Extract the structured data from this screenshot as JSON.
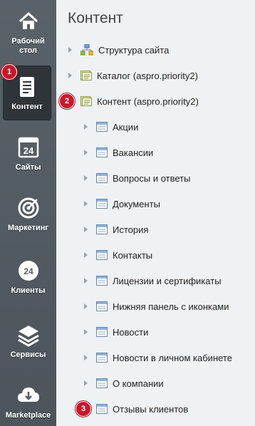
{
  "sidebar": {
    "items": [
      {
        "label": "Рабочий стол",
        "icon": "home-icon"
      },
      {
        "label": "Контент",
        "icon": "document-icon",
        "active": true
      },
      {
        "label": "Сайты",
        "icon": "calendar-24-icon"
      },
      {
        "label": "Маркетинг",
        "icon": "target-icon"
      },
      {
        "label": "Клиенты",
        "icon": "clients-24-icon"
      },
      {
        "label": "Сервисы",
        "icon": "layers-icon"
      },
      {
        "label": "Marketplace",
        "icon": "cloud-download-icon"
      }
    ]
  },
  "badges": [
    "1",
    "2",
    "3"
  ],
  "main": {
    "title": "Контент",
    "tree": [
      {
        "label": "Структура сайта",
        "icon": "site-structure-icon"
      },
      {
        "label": "Каталог (aspro.priority2)",
        "icon": "infoblock-type-icon"
      },
      {
        "label": "Контент (aspro.priority2)",
        "icon": "infoblock-type-icon"
      },
      {
        "label": "Акции",
        "icon": "infoblock-icon"
      },
      {
        "label": "Вакансии",
        "icon": "infoblock-icon"
      },
      {
        "label": "Вопросы и ответы",
        "icon": "infoblock-icon"
      },
      {
        "label": "Документы",
        "icon": "infoblock-icon"
      },
      {
        "label": "История",
        "icon": "infoblock-icon"
      },
      {
        "label": "Контакты",
        "icon": "infoblock-icon"
      },
      {
        "label": "Лицензии и сертификаты",
        "icon": "infoblock-icon"
      },
      {
        "label": "Нижняя панель с иконками",
        "icon": "infoblock-icon"
      },
      {
        "label": "Новости",
        "icon": "infoblock-icon"
      },
      {
        "label": "Новости в личном кабинете",
        "icon": "infoblock-icon"
      },
      {
        "label": "О компании",
        "icon": "infoblock-icon"
      },
      {
        "label": "Отзывы клиентов",
        "icon": "infoblock-icon"
      }
    ]
  },
  "colors": {
    "sidebar": "#555c63",
    "badge": "#c8182b",
    "main_bg": "#eef2f4"
  }
}
